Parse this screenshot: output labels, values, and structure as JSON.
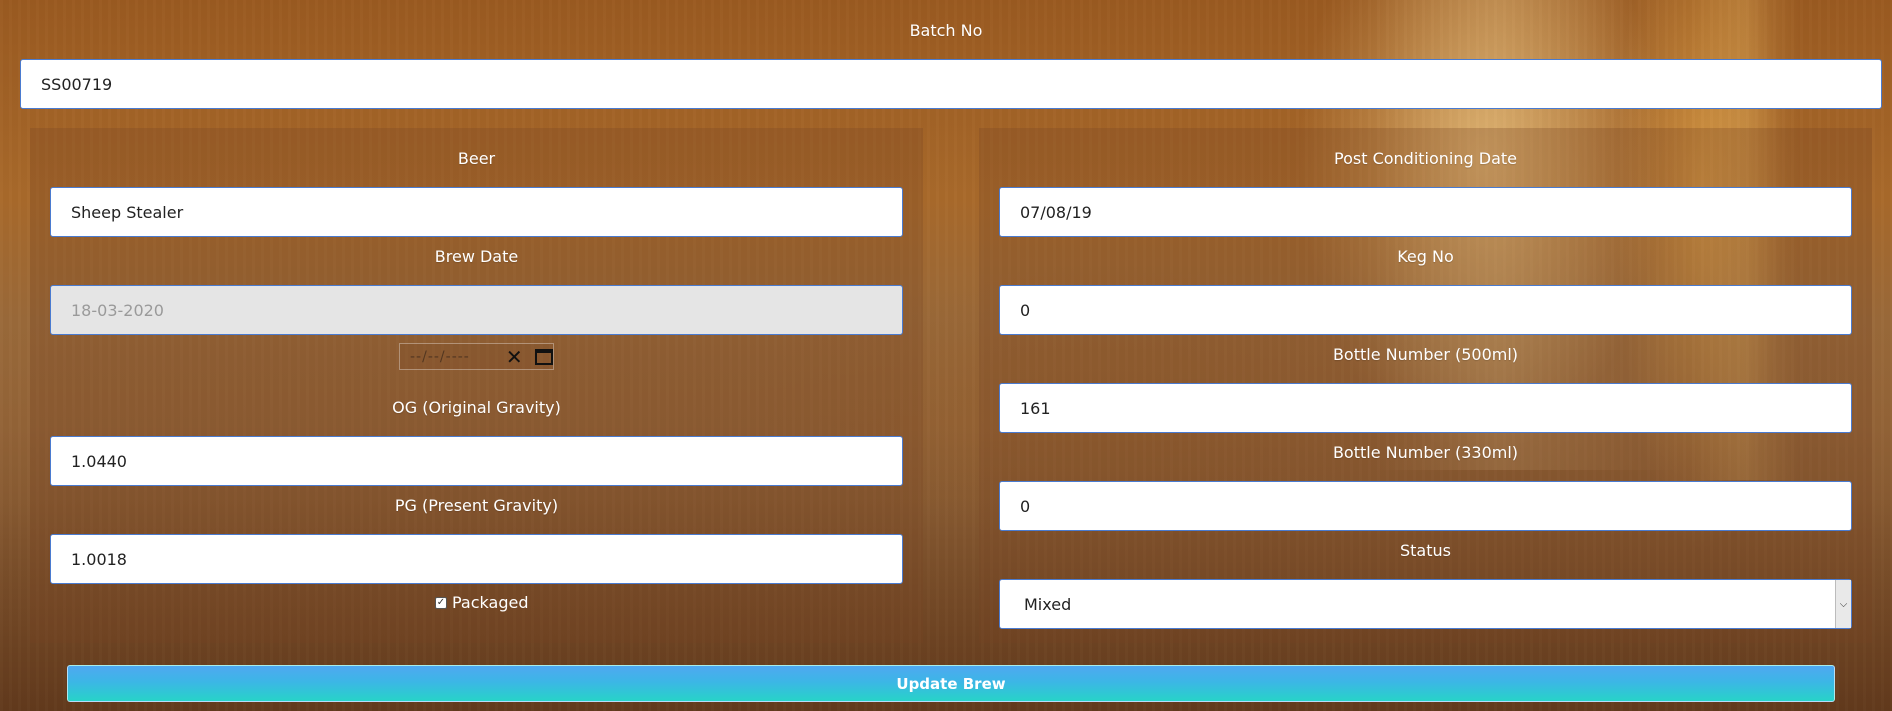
{
  "form": {
    "batch_no": {
      "label": "Batch No",
      "value": "SS00719"
    },
    "left": {
      "beer": {
        "label": "Beer",
        "value": "Sheep Stealer"
      },
      "brew_date": {
        "label": "Brew Date",
        "value": "18-03-2020",
        "picker_placeholder": "--/--/----"
      },
      "og": {
        "label": "OG (Original Gravity)",
        "value": "1.0440"
      },
      "pg": {
        "label": "PG (Present Gravity)",
        "value": "1.0018"
      },
      "packaged": {
        "label": "Packaged",
        "checked": true,
        "mark": "✓"
      }
    },
    "right": {
      "post_conditioning_date": {
        "label": "Post Conditioning Date",
        "value": "07/08/19"
      },
      "keg_no": {
        "label": "Keg No",
        "value": "0"
      },
      "bottle_500": {
        "label": "Bottle Number (500ml)",
        "value": "161"
      },
      "bottle_330": {
        "label": "Bottle Number (330ml)",
        "value": "0"
      },
      "status": {
        "label": "Status",
        "value": "Mixed"
      }
    },
    "submit": {
      "label": "Update Brew"
    }
  },
  "icons": {
    "clear": "close-icon",
    "calendar": "calendar-icon",
    "dropdown": "chevron-down-icon",
    "check": "check-icon"
  },
  "colors": {
    "field_border": "#4a7bd0",
    "button_top": "#4fa8f1",
    "button_bottom": "#27d3c8",
    "label_text": "#ffffff"
  }
}
